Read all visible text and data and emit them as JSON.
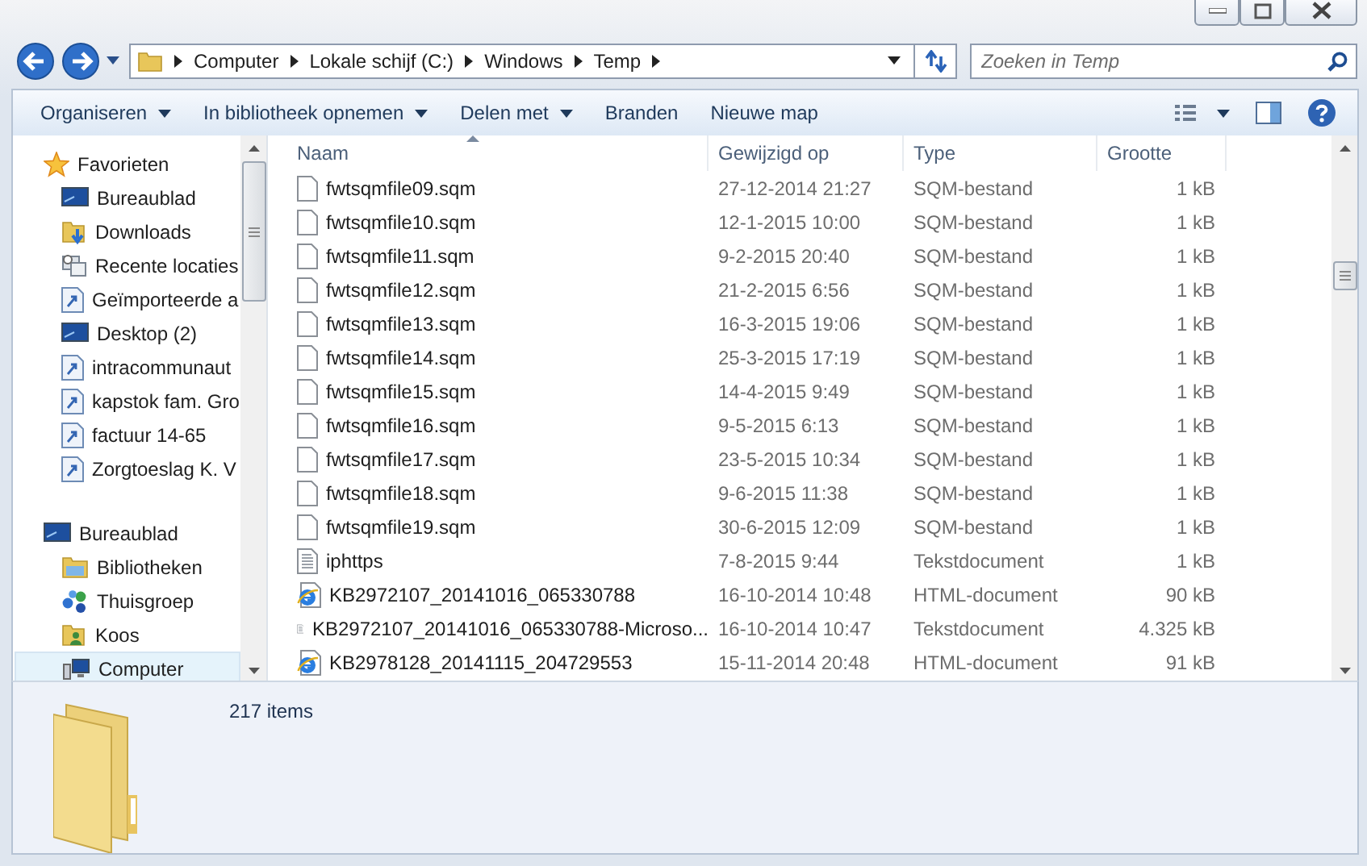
{
  "address": {
    "segments": [
      "Computer",
      "Lokale schijf (C:)",
      "Windows",
      "Temp"
    ]
  },
  "search": {
    "placeholder": "Zoeken in Temp"
  },
  "toolbar": {
    "items": [
      {
        "label": "Organiseren",
        "dropdown": true
      },
      {
        "label": "In bibliotheek opnemen",
        "dropdown": true
      },
      {
        "label": "Delen met",
        "dropdown": true
      },
      {
        "label": "Branden",
        "dropdown": false
      },
      {
        "label": "Nieuwe map",
        "dropdown": false
      }
    ]
  },
  "sidebar": {
    "groups": [
      {
        "label": "Favorieten",
        "kind": "star",
        "items": [
          {
            "label": "Bureaublad",
            "kind": "monitor",
            "selected": false
          },
          {
            "label": "Downloads",
            "kind": "download",
            "selected": false
          },
          {
            "label": "Recente locaties",
            "kind": "recent",
            "selected": false
          },
          {
            "label": "Geïmporteerde a",
            "kind": "shortcut",
            "selected": false
          },
          {
            "label": "Desktop (2)",
            "kind": "monitor",
            "selected": false
          },
          {
            "label": "intracommunaut",
            "kind": "shortcut",
            "selected": false
          },
          {
            "label": "kapstok fam. Gro",
            "kind": "shortcut",
            "selected": false
          },
          {
            "label": "factuur 14-65",
            "kind": "shortcut",
            "selected": false
          },
          {
            "label": "Zorgtoeslag K. V",
            "kind": "shortcut",
            "selected": false
          }
        ]
      },
      {
        "label": "Bureaublad",
        "kind": "monitor",
        "items": [
          {
            "label": "Bibliotheken",
            "kind": "library",
            "selected": false
          },
          {
            "label": "Thuisgroep",
            "kind": "homegroup",
            "selected": false
          },
          {
            "label": "Koos",
            "kind": "user",
            "selected": false
          },
          {
            "label": "Computer",
            "kind": "computer",
            "selected": true
          }
        ]
      }
    ]
  },
  "table": {
    "columns": [
      {
        "label": "Naam",
        "sorted": true
      },
      {
        "label": "Gewijzigd op",
        "sorted": false
      },
      {
        "label": "Type",
        "sorted": false
      },
      {
        "label": "Grootte",
        "sorted": false
      }
    ],
    "rows": [
      {
        "kind": "file",
        "name": "fwtsqmfile09.sqm",
        "modified": "27-12-2014 21:27",
        "type": "SQM-bestand",
        "size": "1 kB"
      },
      {
        "kind": "file",
        "name": "fwtsqmfile10.sqm",
        "modified": "12-1-2015 10:00",
        "type": "SQM-bestand",
        "size": "1 kB"
      },
      {
        "kind": "file",
        "name": "fwtsqmfile11.sqm",
        "modified": "9-2-2015 20:40",
        "type": "SQM-bestand",
        "size": "1 kB"
      },
      {
        "kind": "file",
        "name": "fwtsqmfile12.sqm",
        "modified": "21-2-2015 6:56",
        "type": "SQM-bestand",
        "size": "1 kB"
      },
      {
        "kind": "file",
        "name": "fwtsqmfile13.sqm",
        "modified": "16-3-2015 19:06",
        "type": "SQM-bestand",
        "size": "1 kB"
      },
      {
        "kind": "file",
        "name": "fwtsqmfile14.sqm",
        "modified": "25-3-2015 17:19",
        "type": "SQM-bestand",
        "size": "1 kB"
      },
      {
        "kind": "file",
        "name": "fwtsqmfile15.sqm",
        "modified": "14-4-2015 9:49",
        "type": "SQM-bestand",
        "size": "1 kB"
      },
      {
        "kind": "file",
        "name": "fwtsqmfile16.sqm",
        "modified": "9-5-2015 6:13",
        "type": "SQM-bestand",
        "size": "1 kB"
      },
      {
        "kind": "file",
        "name": "fwtsqmfile17.sqm",
        "modified": "23-5-2015 10:34",
        "type": "SQM-bestand",
        "size": "1 kB"
      },
      {
        "kind": "file",
        "name": "fwtsqmfile18.sqm",
        "modified": "9-6-2015 11:38",
        "type": "SQM-bestand",
        "size": "1 kB"
      },
      {
        "kind": "file",
        "name": "fwtsqmfile19.sqm",
        "modified": "30-6-2015 12:09",
        "type": "SQM-bestand",
        "size": "1 kB"
      },
      {
        "kind": "text",
        "name": "iphttps",
        "modified": "7-8-2015 9:44",
        "type": "Tekstdocument",
        "size": "1 kB"
      },
      {
        "kind": "html",
        "name": "KB2972107_20141016_065330788",
        "modified": "16-10-2014 10:48",
        "type": "HTML-document",
        "size": "90 kB"
      },
      {
        "kind": "text",
        "name": "KB2972107_20141016_065330788-Microso...",
        "modified": "16-10-2014 10:47",
        "type": "Tekstdocument",
        "size": "4.325 kB"
      },
      {
        "kind": "html",
        "name": "KB2978128_20141115_204729553",
        "modified": "15-11-2014 20:48",
        "type": "HTML-document",
        "size": "91 kB"
      }
    ]
  },
  "details": {
    "count": "217 items"
  }
}
